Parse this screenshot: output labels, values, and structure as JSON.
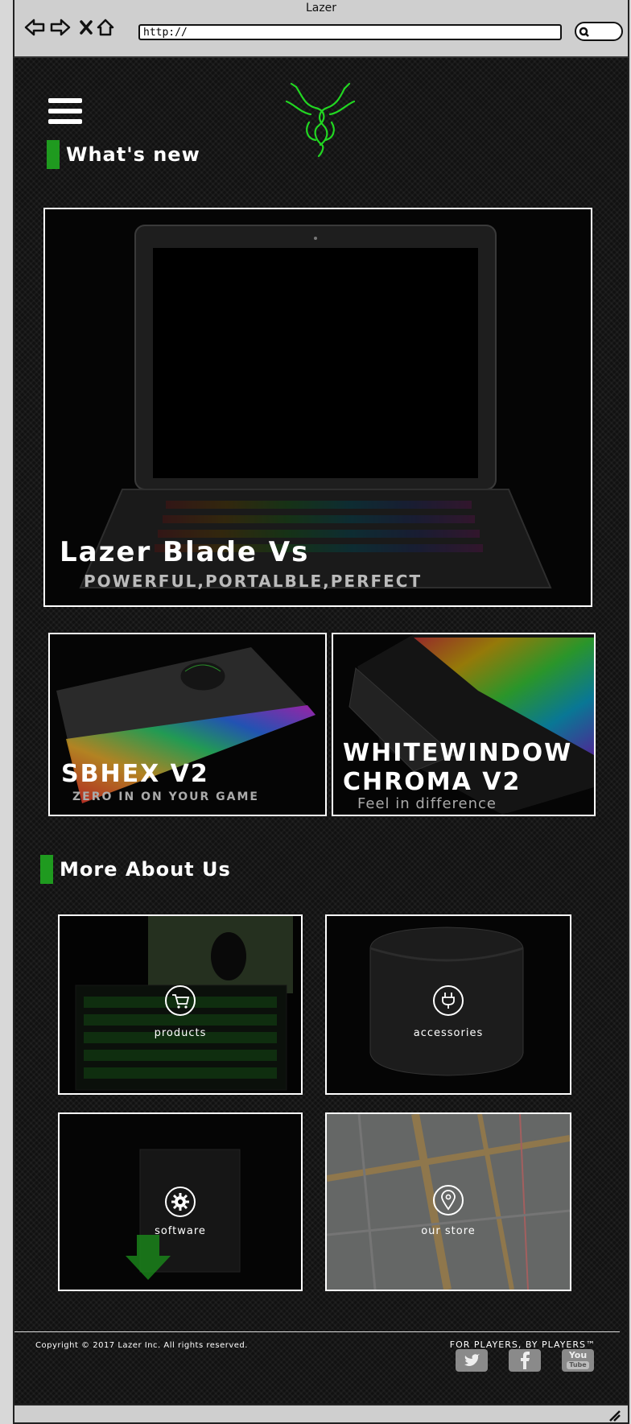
{
  "window": {
    "title": "Lazer"
  },
  "addressbar": {
    "url": "http://"
  },
  "sections": {
    "whats_new": "What's new",
    "more_about": "More About Us"
  },
  "hero": {
    "title": "Lazer Blade Vs",
    "subtitle": "POWERFUL,PORTALBLE,PERFECT"
  },
  "feature_left": {
    "title": "SBHEX V2",
    "subtitle": "ZERO IN ON YOUR GAME"
  },
  "feature_right": {
    "title_line1": "WHITEWINDOW",
    "title_line2": "CHROMA V2",
    "subtitle": "Feel in difference"
  },
  "tiles": [
    {
      "label": "products",
      "icon": "cart-icon"
    },
    {
      "label": "accessories",
      "icon": "plug-icon"
    },
    {
      "label": "software",
      "icon": "gear-icon"
    },
    {
      "label": "our store",
      "icon": "map-pin-icon"
    }
  ],
  "footer": {
    "copyright": "Copyright © 2017 Lazer Inc. All rights reserved.",
    "motto": "FOR PLAYERS, BY PLAYERS™",
    "social": [
      "twitter-icon",
      "facebook-icon",
      "youtube-icon"
    ],
    "youtube_text_1": "You",
    "youtube_text_2": "Tube"
  },
  "colors": {
    "accent": "#1f9a1f",
    "logo": "#22d622"
  }
}
